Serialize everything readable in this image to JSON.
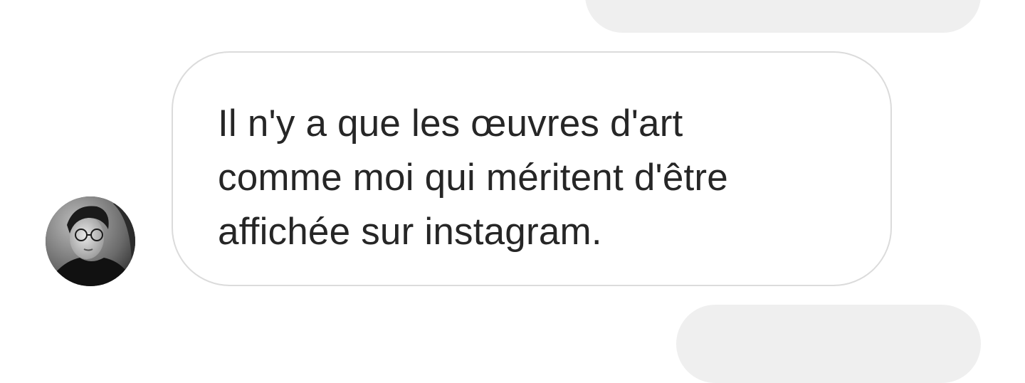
{
  "conversation": {
    "received_message": {
      "sender_avatar": "user-avatar-icon",
      "text": "Il n'y a que les œuvres d'art\ncomme moi qui méritent d'être\naffichée sur instagram."
    }
  },
  "colors": {
    "background": "#ffffff",
    "sent_bubble": "#efefef",
    "received_bubble_border": "#dbdbdb",
    "text": "#262626"
  }
}
